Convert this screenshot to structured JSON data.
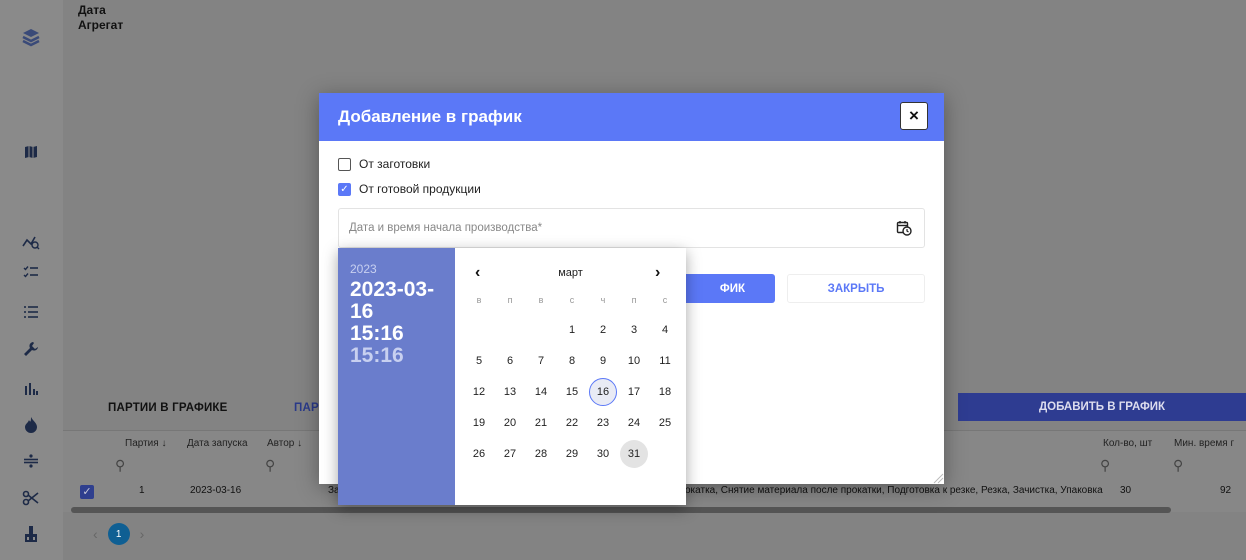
{
  "header": {
    "date_label": "Дата",
    "unit_label": "Агрегат"
  },
  "tabs": {
    "parties": "ПАРТИИ В ГРАФИКЕ",
    "other": "ПАР"
  },
  "add_button": "ДОБАВИТЬ В ГРАФИК",
  "table": {
    "columns": {
      "party": "Партия ↓",
      "launch_date": "Дата запуска",
      "author": "Автор ↓",
      "qty": "Кол-во, шт",
      "min_time": "Мин. время г"
    },
    "row": {
      "party": "1",
      "launch_date": "2023-03-16",
      "ops_prefix": "За",
      "ops": "окатка, Снятие материала после прокатки, Подготовка к резке, Резка, Зачистка, Упаковка",
      "qty": "30",
      "min_time": "92"
    }
  },
  "pager": {
    "current": "1"
  },
  "modal": {
    "title": "Добавление в график",
    "close_icon": "×",
    "from_blank": "От заготовки",
    "from_finished": "От готовой продукции",
    "from_blank_checked": false,
    "from_finished_checked": true,
    "date_placeholder": "Дата и время начала производства*",
    "save_button_partial": "ФИК",
    "close_button": "ЗАКРЫТЬ"
  },
  "picker": {
    "year": "2023",
    "date": "2023-03-16",
    "time": "15:16",
    "time2": "15:16",
    "month": "март",
    "weekdays": [
      "в",
      "п",
      "в",
      "с",
      "ч",
      "п",
      "с"
    ],
    "days": [
      "1",
      "2",
      "3",
      "4",
      "5",
      "6",
      "7",
      "8",
      "9",
      "10",
      "11",
      "12",
      "13",
      "14",
      "15",
      "16",
      "17",
      "18",
      "19",
      "20",
      "21",
      "22",
      "23",
      "24",
      "25",
      "26",
      "27",
      "28",
      "29",
      "30",
      "31"
    ],
    "selected_day": "16",
    "highlight_day": "31"
  },
  "colors": {
    "accent": "#5b78f7",
    "picker_side": "#6a7dcc",
    "add_button": "#2e3c91"
  }
}
